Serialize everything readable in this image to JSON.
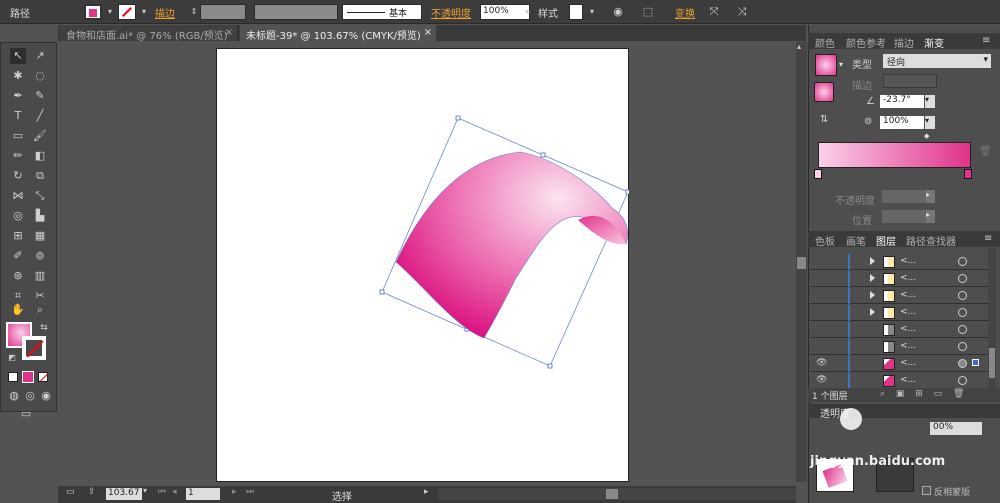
{
  "toolbar": {
    "path_label": "路径",
    "stroke_label": "描边",
    "stroke_profile": "基本",
    "opacity_label": "不透明度",
    "opacity_value": "100%",
    "style_label": "样式",
    "transform_label": "变换"
  },
  "tabs": [
    {
      "label": "食物和店面.ai* @ 76% (RGB/预览)",
      "close": "×"
    },
    {
      "label": "未标题-39* @ 103.67% (CMYK/预览)",
      "close": "×"
    }
  ],
  "gradient_panel": {
    "tabs": [
      "颜色",
      "颜色参考",
      "描边",
      "渐变"
    ],
    "type_label": "类型",
    "type_value": "径向",
    "stroke_label": "描边",
    "angle_value": "-23.7°",
    "aspect_value": "100%",
    "opacity_label": "不透明度",
    "location_label": "位置"
  },
  "layers_panel": {
    "tabs": [
      "色板",
      "画笔",
      "图层",
      "路径查找器"
    ],
    "rows": [
      "<...",
      "<...",
      "<...",
      "<...",
      "<...",
      "<...",
      "<...",
      "<..."
    ],
    "footer": "1 个图层"
  },
  "transparency_panel": {
    "title": "透明度",
    "opacity_value": "00%",
    "invert_label": "反相蒙版"
  },
  "status": {
    "zoom": "103.67",
    "page": "1",
    "tool": "选择"
  },
  "watermark": {
    "text": "jingyan.baidu.com"
  },
  "colors": {
    "accent": "#e0338a",
    "bg": "#535353"
  }
}
